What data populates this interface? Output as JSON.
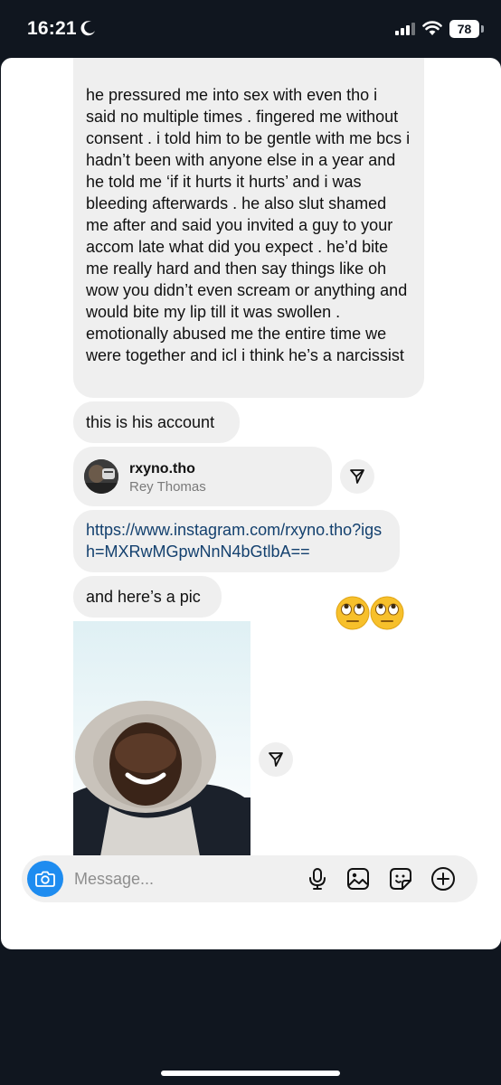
{
  "status_bar": {
    "time": "16:21",
    "battery": "78"
  },
  "messages": {
    "long_message": "he pressured me into sex with even tho i said no multiple times . fingered me without consent . i told him to be gentle with me bcs i hadn’t been with anyone else in a year and he told me ‘if it hurts it hurts’ and i was bleeding afterwards . he also slut shamed me after and said you invited a guy to your accom late what did you expect . he’d bite me really hard and then say things like oh wow you didn’t even scream or anything and would bite my lip till it was swollen . emotionally abused me the entire time we were together and icl i think he’s a narcissist",
    "account_intro": "this is his account",
    "link": "https://www.instagram.com/rxyno.tho?igsh=MXRwMGpwNnN4bGtlbA==",
    "pic_intro": "and here’s a pic",
    "reaction": "🙄🙄"
  },
  "shared_profile": {
    "handle": "rxyno.tho",
    "name": "Rey Thomas"
  },
  "composer": {
    "placeholder": "Message..."
  },
  "colors": {
    "bubble": "#efefef",
    "link": "#13406e",
    "camera_button": "#1e8cf0",
    "background": "#10161f"
  },
  "icons": [
    "moon-icon",
    "signal-icon",
    "wifi-icon",
    "share-icon",
    "camera-icon",
    "mic-icon",
    "gallery-icon",
    "sticker-icon",
    "plus-icon"
  ]
}
